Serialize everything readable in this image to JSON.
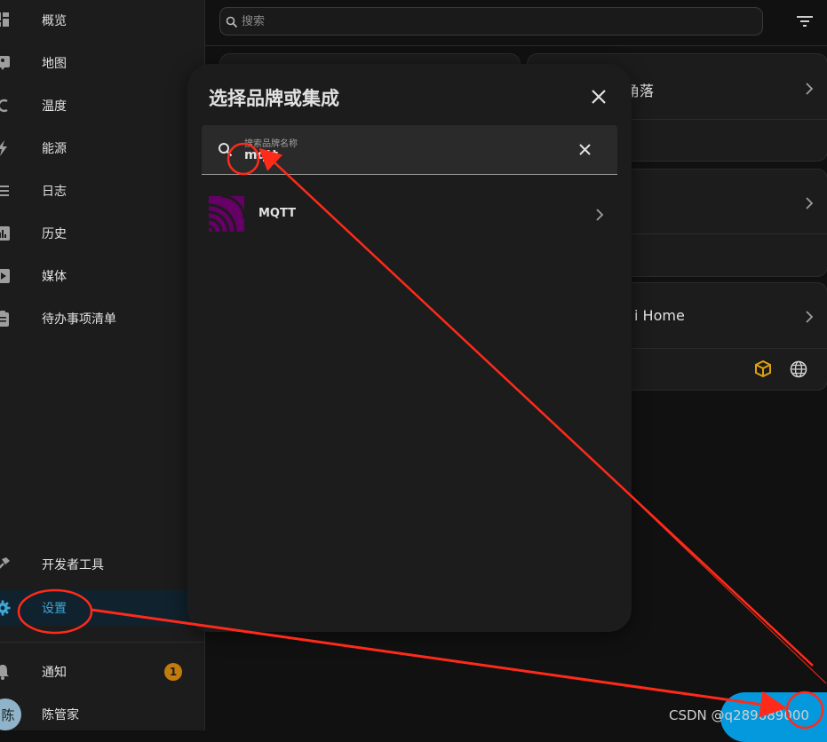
{
  "sidebar": {
    "items": [
      {
        "label": "概览",
        "icon": "dashboard-icon"
      },
      {
        "label": "地图",
        "icon": "map-icon"
      },
      {
        "label": "温度",
        "icon": "thermometer-icon"
      },
      {
        "label": "能源",
        "icon": "lightning-icon"
      },
      {
        "label": "日志",
        "icon": "list-icon"
      },
      {
        "label": "历史",
        "icon": "chart-icon"
      },
      {
        "label": "媒体",
        "icon": "play-icon"
      },
      {
        "label": "待办事项清单",
        "icon": "clipboard-icon"
      }
    ],
    "developer_tools": "开发者工具",
    "settings": "设置",
    "notifications": "通知",
    "notification_count": "1",
    "user_name": "陈管家",
    "user_initial": "陈"
  },
  "topbar": {
    "search_placeholder": "搜索"
  },
  "cards": [
    {
      "title": "角落"
    },
    {
      "title": ""
    },
    {
      "title": "i Home"
    }
  ],
  "dialog": {
    "title": "选择品牌或集成",
    "search_label": "搜索品牌名称",
    "search_value": "mqtt",
    "results": [
      {
        "name": "MQTT"
      }
    ]
  },
  "watermark": "CSDN @q289689000",
  "colors": {
    "accent": "#03a9f4",
    "active_text": "#3ea6d6",
    "annotation_red": "#ff2a1a",
    "mqtt_brand": "#660066",
    "badge": "#c27c0e"
  }
}
